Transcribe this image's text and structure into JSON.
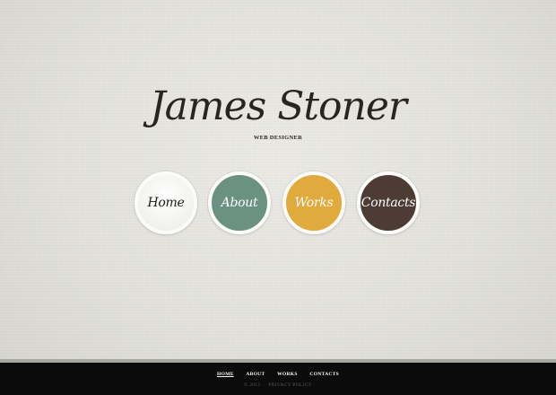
{
  "header": {
    "logo_text": "James Stoner",
    "tagline": "WEB DESIGNER"
  },
  "nav": {
    "items": [
      {
        "label": "Home",
        "color": "#f3f3f1"
      },
      {
        "label": "About",
        "color": "#6b9183"
      },
      {
        "label": "Works",
        "color": "#e1aa3d"
      },
      {
        "label": "Contacts",
        "color": "#4d3c33"
      }
    ]
  },
  "footer": {
    "links": [
      "HOME",
      "ABOUT",
      "WORKS",
      "CONTACTS"
    ],
    "active": "HOME",
    "copyright": "© 2012",
    "privacy": "PRIVACY POLICY"
  }
}
